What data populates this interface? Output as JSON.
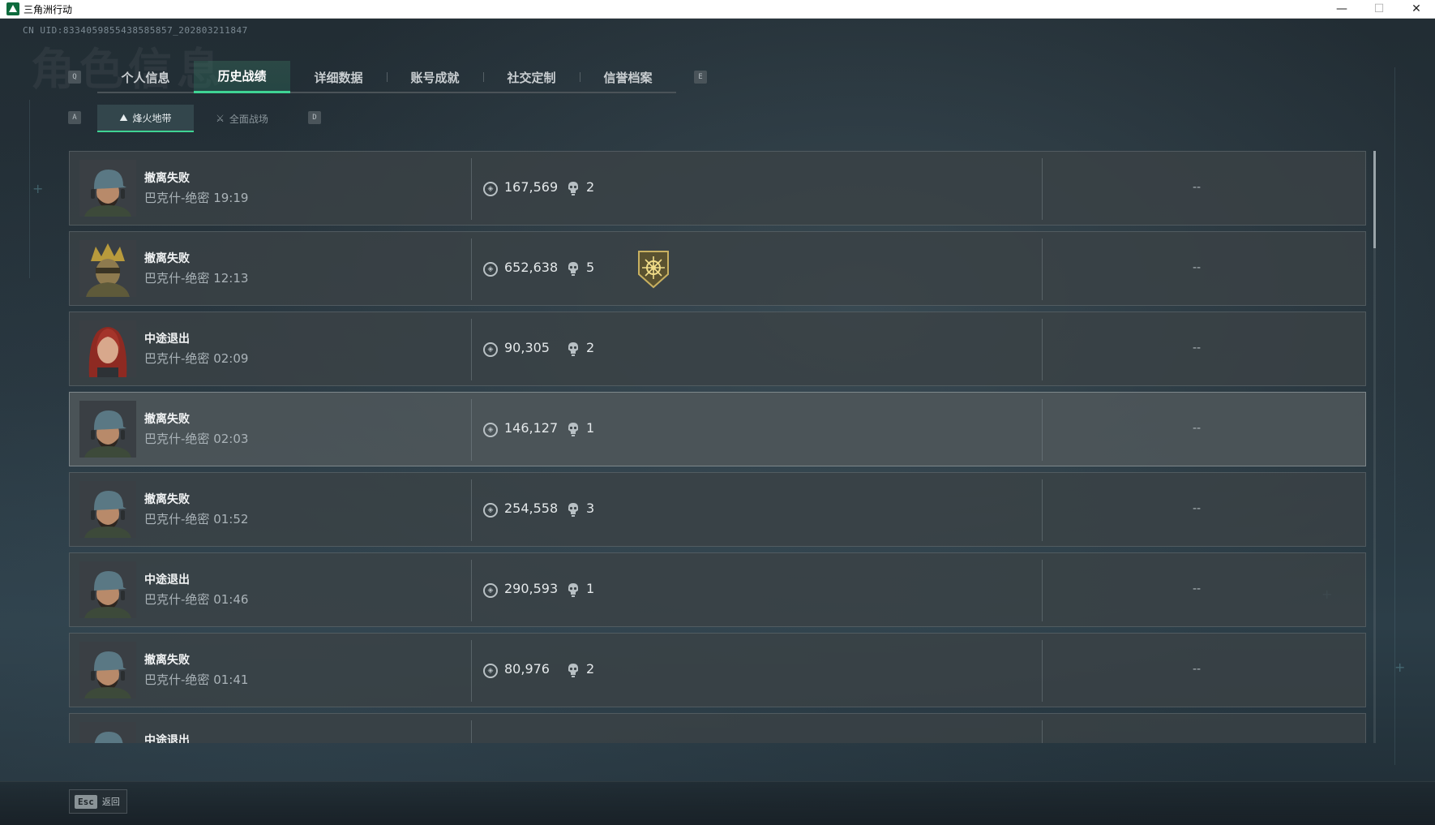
{
  "window": {
    "title": "三角洲行动",
    "minimize_glyph": "—",
    "maximize_glyph": "☐",
    "close_glyph": "✕"
  },
  "uid": "CN UID:8334059855438585857_202803211847",
  "background_title": "角色信息",
  "tabs": {
    "prev_key": "Q",
    "next_key": "E",
    "items": [
      {
        "label": "个人信息",
        "active": false
      },
      {
        "label": "历史战绩",
        "active": true
      },
      {
        "label": "详细数据",
        "active": false
      },
      {
        "label": "账号成就",
        "active": false
      },
      {
        "label": "社交定制",
        "active": false
      },
      {
        "label": "信誉档案",
        "active": false
      }
    ]
  },
  "subtabs": {
    "prev_key": "A",
    "next_key": "D",
    "items": [
      {
        "label": "烽火地带",
        "icon": "extraction-mode-icon",
        "active": true
      },
      {
        "label": "全面战场",
        "icon": "warfare-mode-icon",
        "active": false
      }
    ]
  },
  "matches": [
    {
      "status": "撤离失败",
      "map": "巴克什-绝密",
      "time": "19:19",
      "value": "167,569",
      "kills": "2",
      "result": "--",
      "avatar": "operator-cap",
      "medal": false
    },
    {
      "status": "撤离失败",
      "map": "巴克什-绝密",
      "time": "12:13",
      "value": "652,638",
      "kills": "5",
      "result": "--",
      "avatar": "operator-crown",
      "medal": true
    },
    {
      "status": "中途退出",
      "map": "巴克什-绝密",
      "time": "02:09",
      "value": "90,305",
      "kills": "2",
      "result": "--",
      "avatar": "operator-redhair",
      "medal": false
    },
    {
      "status": "撤离失败",
      "map": "巴克什-绝密",
      "time": "02:03",
      "value": "146,127",
      "kills": "1",
      "result": "--",
      "avatar": "operator-cap",
      "medal": false
    },
    {
      "status": "撤离失败",
      "map": "巴克什-绝密",
      "time": "01:52",
      "value": "254,558",
      "kills": "3",
      "result": "--",
      "avatar": "operator-cap",
      "medal": false
    },
    {
      "status": "中途退出",
      "map": "巴克什-绝密",
      "time": "01:46",
      "value": "290,593",
      "kills": "1",
      "result": "--",
      "avatar": "operator-cap",
      "medal": false
    },
    {
      "status": "撤离失败",
      "map": "巴克什-绝密",
      "time": "01:41",
      "value": "80,976",
      "kills": "2",
      "result": "--",
      "avatar": "operator-cap",
      "medal": false
    },
    {
      "status": "中途退出",
      "map": "",
      "time": "",
      "value": "",
      "kills": "",
      "result": "",
      "avatar": "operator-cap",
      "medal": false
    }
  ],
  "highlight_row": 3,
  "footer": {
    "back_key": "Esc",
    "back_label": "返回"
  },
  "colors": {
    "accent": "#3fd494",
    "row_bg": "#3a4246",
    "text": "#e4e8ea"
  }
}
